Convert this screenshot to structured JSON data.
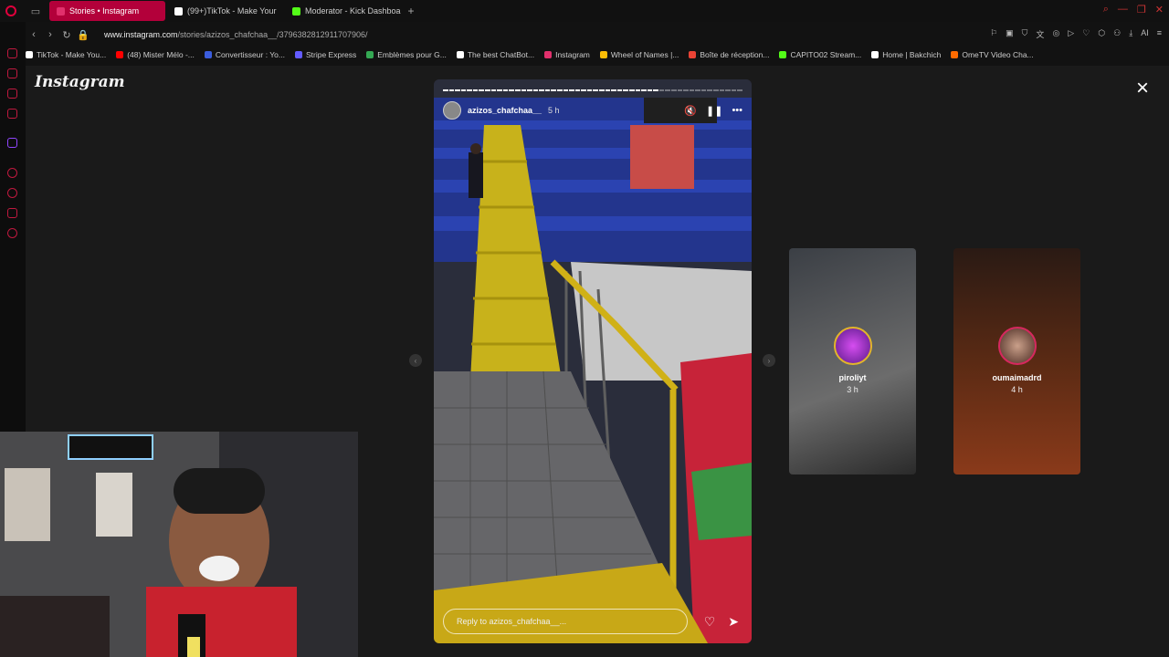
{
  "tabs": [
    {
      "label": "Stories • Instagram",
      "active": true,
      "favicon_color": "#e1306c"
    },
    {
      "label": "(99+)TikTok - Make Your",
      "active": false,
      "favicon_color": "#ffffff"
    },
    {
      "label": "Moderator - Kick Dashboa",
      "active": false,
      "favicon_color": "#53fc18"
    }
  ],
  "address": {
    "host": "www.instagram.com",
    "path": "/stories/azizos_chafchaa__/3796382812911707906/"
  },
  "bookmarks": [
    {
      "label": "TikTok - Make You...",
      "color": "#ffffff"
    },
    {
      "label": "(48) Mister Mélo -...",
      "color": "#ff0000"
    },
    {
      "label": "Convertisseur : Yo...",
      "color": "#3b5ddd"
    },
    {
      "label": "Stripe Express",
      "color": "#635bff"
    },
    {
      "label": "Emblèmes pour G...",
      "color": "#34a853"
    },
    {
      "label": "The best ChatBot...",
      "color": "#ffffff"
    },
    {
      "label": "Instagram",
      "color": "#e1306c"
    },
    {
      "label": "Wheel of Names |...",
      "color": "#fbbc05"
    },
    {
      "label": "Boîte de réception...",
      "color": "#ea4335"
    },
    {
      "label": "CAPITO02 Stream...",
      "color": "#53fc18"
    },
    {
      "label": "Home | Bakchich",
      "color": "#ffffff"
    },
    {
      "label": "OmeTV Video Cha...",
      "color": "#ff6b00"
    }
  ],
  "instagram": {
    "logo": "Instagram",
    "close_icon": "×"
  },
  "story": {
    "username": "azizos_chafchaa__",
    "time": "5 h",
    "reply_placeholder": "Reply to azizos_chafchaa__...",
    "progress_fraction": 0.72
  },
  "side_stories": [
    {
      "username": "piroliyt",
      "time": "3 h"
    },
    {
      "username": "oumaimadrd",
      "time": "4 h"
    }
  ],
  "icons": {
    "mute": "🔇",
    "pause": "❚❚",
    "more": "•••",
    "heart": "♡",
    "send": "➤",
    "prev": "‹",
    "next": "›"
  }
}
